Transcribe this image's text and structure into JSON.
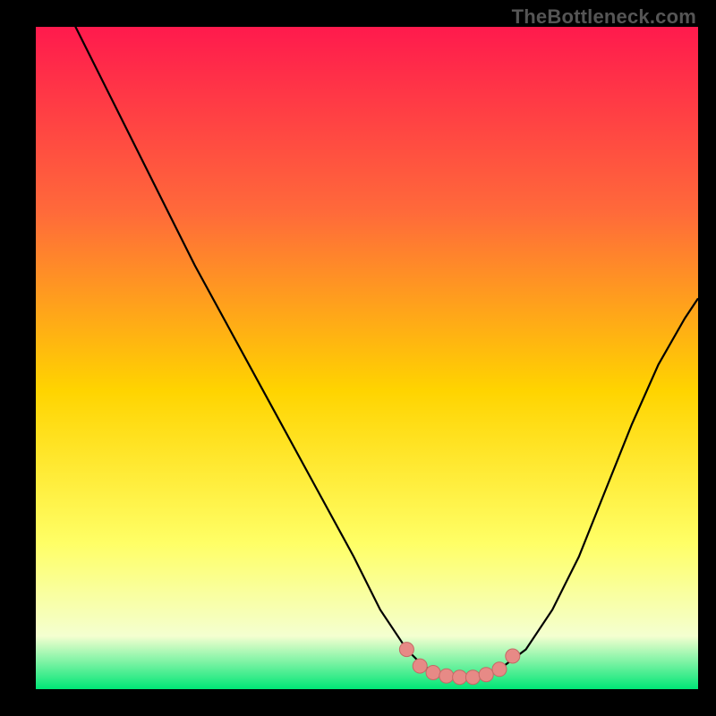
{
  "watermark": "TheBottleneck.com",
  "colors": {
    "bg_black": "#000000",
    "grad_top": "#ff1a4d",
    "grad_mid1": "#ff6a3a",
    "grad_mid2": "#ffd400",
    "grad_mid3": "#ffff66",
    "grad_mid4": "#f4ffd0",
    "grad_bottom": "#00e676",
    "curve": "#000000",
    "marker_fill": "#e78a86",
    "marker_stroke": "#c46a66"
  },
  "chart_data": {
    "type": "line",
    "title": "",
    "xlabel": "",
    "ylabel": "",
    "xlim": [
      0,
      100
    ],
    "ylim": [
      0,
      100
    ],
    "series": [
      {
        "name": "curve",
        "x": [
          0,
          6,
          12,
          18,
          24,
          30,
          36,
          42,
          48,
          52,
          56,
          58,
          60,
          62,
          64,
          66,
          68,
          70,
          74,
          78,
          82,
          86,
          90,
          94,
          98,
          100
        ],
        "y": [
          113,
          100,
          88,
          76,
          64,
          53,
          42,
          31,
          20,
          12,
          6,
          4,
          2.5,
          2,
          1.8,
          1.8,
          2,
          3,
          6,
          12,
          20,
          30,
          40,
          49,
          56,
          59
        ]
      }
    ],
    "markers": {
      "name": "highlight-points",
      "x": [
        56,
        58,
        60,
        62,
        64,
        66,
        68,
        70,
        72
      ],
      "y": [
        6,
        3.5,
        2.5,
        2,
        1.8,
        1.8,
        2.2,
        3,
        5
      ]
    }
  }
}
